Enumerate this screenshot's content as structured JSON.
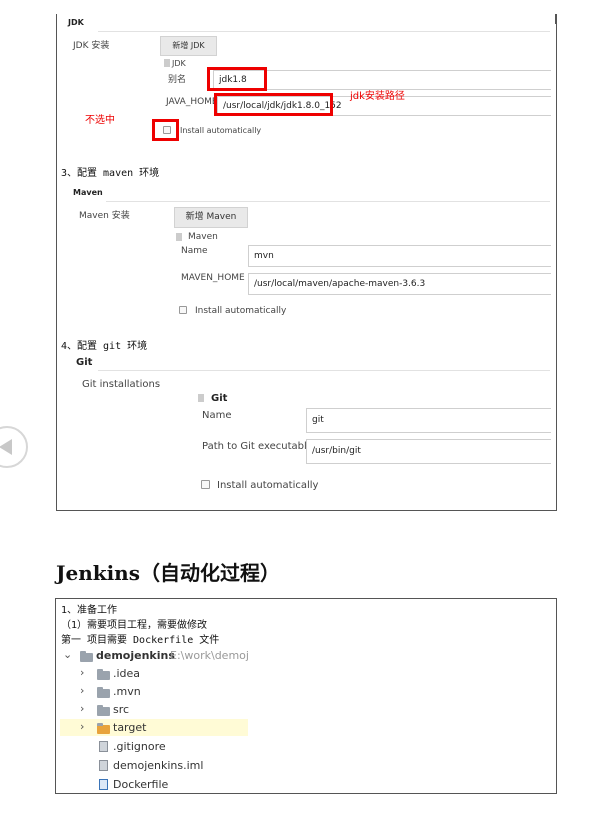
{
  "jdk": {
    "section": "JDK",
    "install_label": "JDK 安装",
    "add_button": "新增 JDK",
    "entry_title": "JDK",
    "alias_label": "别名",
    "alias_value": "jdk1.8",
    "home_label": "JAVA_HOME",
    "home_value": "/usr/local/jdk/jdk1.8.0_152",
    "path_annotation": "jdk安装路径",
    "uncheck_annotation": "不选中",
    "install_auto": "Install automatically"
  },
  "maven": {
    "heading": "3、配置 maven 环境",
    "section": "Maven",
    "install_label": "Maven 安装",
    "add_button": "新增 Maven",
    "entry_title": "Maven",
    "name_label": "Name",
    "name_value": "mvn",
    "home_label": "MAVEN_HOME",
    "home_value": "/usr/local/maven/apache-maven-3.6.3",
    "install_auto": "Install automatically"
  },
  "git": {
    "heading": "4、配置 git 环境",
    "section": "Git",
    "install_label": "Git installations",
    "entry_title": "Git",
    "name_label": "Name",
    "name_value": "git",
    "path_label": "Path to Git executable",
    "path_value": "/usr/bin/git",
    "install_auto": "Install automatically"
  },
  "article": {
    "title": "Jenkins（自动化过程）"
  },
  "steps": {
    "line1": "1、准备工作",
    "line2": "（1）需要项目工程，需要做修改",
    "line3": "第一 项目需要 Dockerfile 文件"
  },
  "project": {
    "root_name": "demojenkins",
    "root_path": "E:\\work\\demojenkins",
    "items": [
      ".idea",
      ".mvn",
      "src",
      "target",
      ".gitignore",
      "demojenkins.iml",
      "Dockerfile"
    ]
  },
  "colors": {
    "annotation_red": "#ee0000",
    "target_highlight": "#fffbd6",
    "target_folder": "#e8a33c"
  },
  "icons": {
    "prev": "chevron-left-circle-icon"
  }
}
